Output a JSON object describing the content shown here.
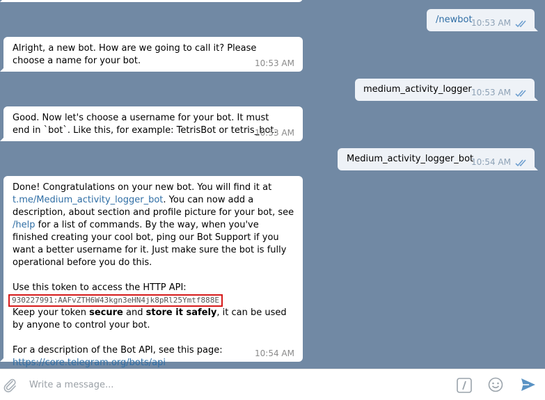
{
  "messages": [
    {
      "dir": "out",
      "text": "/newbot",
      "time": "10:53 AM"
    },
    {
      "dir": "in",
      "text": "Alright, a new bot. How are we going to call it? Please choose a name for your bot.",
      "time": "10:53 AM"
    },
    {
      "dir": "out",
      "text": "medium_activity_logger",
      "time": "10:53 AM"
    },
    {
      "dir": "in",
      "text": "Good. Now let's choose a username for your bot. It must end in `bot`. Like this, for example: TetrisBot or tetris_bot.",
      "time": "10:53 AM"
    },
    {
      "dir": "out",
      "text": "Medium_activity_logger_bot",
      "time": "10:54 AM"
    },
    {
      "dir": "in",
      "time": "10:54 AM",
      "p1": "Done! Congratulations on your new bot. You will find it at",
      "link1": "t.me/Medium_activity_logger_bot",
      "p1b": ". You can now add a description, about section and profile picture for your bot, see",
      "help": "/help",
      "p1c": "for a list of commands. By the way, when you've finished creating your cool bot, ping our Bot Support if you want a better username for it. Just make sure the bot is fully operational before you do this.",
      "p2": "Use this token to access the HTTP API:",
      "token": "930227991:AAFvZTH6W43kgn3eHN4jk8pRl25Ymtf888E",
      "p3a": "Keep your token",
      "p3b": "secure",
      "p3c": "and",
      "p3d": "store it safely",
      "p3e": ", it can be used by anyone to control your bot.",
      "p4": "For a description of the Bot API, see this page:",
      "link2": "https://core.telegram.org/bots/api"
    }
  ],
  "composer": {
    "placeholder": "Write a message..."
  },
  "icons": [
    "attach-icon",
    "bot-command-icon",
    "emoji-icon",
    "send-icon"
  ],
  "colors": {
    "chat_bg": "#7189a4",
    "link": "#2f6ea5",
    "highlight": "#d61a1a"
  }
}
